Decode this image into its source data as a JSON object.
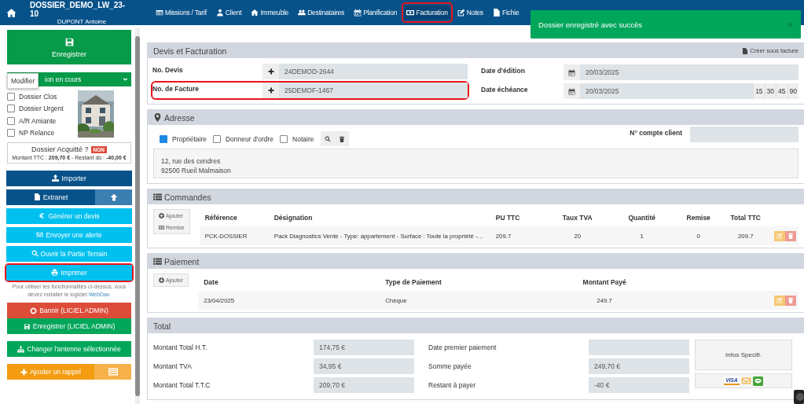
{
  "topbar": {
    "title": "DOSSIER_DEMO_LW_23-10",
    "subtitle": "DUPONT Antoine",
    "tabs": [
      {
        "label": "Missions / Tarif",
        "selected": false,
        "highlighted": false
      },
      {
        "label": "Client",
        "selected": false,
        "highlighted": false
      },
      {
        "label": "Immeuble",
        "selected": false,
        "highlighted": false
      },
      {
        "label": "Destinataires",
        "selected": false,
        "highlighted": false
      },
      {
        "label": "Planification",
        "selected": false,
        "highlighted": false
      },
      {
        "label": "Facturation",
        "selected": true,
        "highlighted": true
      },
      {
        "label": "Notes",
        "selected": false,
        "highlighted": false
      },
      {
        "label": "Fichie",
        "selected": false,
        "highlighted": false
      }
    ]
  },
  "toast": {
    "message": "Dossier enregistré avec succès",
    "close": "×"
  },
  "tooltip": "Modifier",
  "sidebar": {
    "save_button": "Enregistrer",
    "status": "ion en cours",
    "checkboxes": [
      {
        "label": "Dossier Clos",
        "checked": false
      },
      {
        "label": "Dossier Urgent",
        "checked": false
      },
      {
        "label": "A/R Amiante",
        "checked": false
      },
      {
        "label": "NP Relance",
        "checked": false
      }
    ],
    "acquitte": {
      "label": "Dossier Acquitté ?",
      "badge": "NON",
      "summary": "Montant TTC : **209,70 €** - Restant dû : **-40,00 €**"
    },
    "buttons": [
      {
        "label": "Importer",
        "kind": "primary",
        "highlighted": false
      },
      {
        "label": "Extranet",
        "kind": "primary",
        "highlighted": false
      },
      {
        "label": "Générer un devis",
        "kind": "info",
        "highlighted": false
      },
      {
        "label": "Envoyer une alerte",
        "kind": "info",
        "highlighted": false
      },
      {
        "label": "Ouvrir la Partie Terrain",
        "kind": "info",
        "highlighted": false
      },
      {
        "label": "Imprimer",
        "kind": "info",
        "highlighted": true
      }
    ],
    "note": {
      "text": "Pour utiliser les fonctionnalités ci-dessus, vous devez installer le logiciel",
      "link": "WebDav",
      "end": "."
    },
    "admin_buttons": [
      {
        "label": "Bannir (LICIEL ADMIN)",
        "kind": "danger"
      },
      {
        "label": "Enregistrer (LICIEL ADMIN)",
        "kind": "success"
      },
      {
        "label": "Changer l'antenne sélectionnée",
        "kind": "success"
      },
      {
        "label": "Ajouter un rappel",
        "kind": "warning"
      }
    ]
  },
  "devis": {
    "title": "Devis et Facturation",
    "create_link": "Créer sous facture",
    "fields": [
      {
        "label": "No. Devis",
        "value": "24DEMOD-2644",
        "highlighted": false
      },
      {
        "label": "No. de Facture",
        "value": "25DEMOF-1467",
        "highlighted": true
      }
    ],
    "dates": [
      {
        "label": "Date d'édition",
        "value": "20/03/2025"
      },
      {
        "label": "Date échéance",
        "value": "20/03/2025"
      }
    ],
    "delays": [
      "15",
      "30",
      "45",
      "90"
    ]
  },
  "adresse": {
    "title": "Adresse",
    "checkboxes": [
      {
        "label": "Propriétaire",
        "checked": true
      },
      {
        "label": "Donneur d'ordre",
        "checked": false
      },
      {
        "label": "Notaire",
        "checked": false
      }
    ],
    "account_label": "N° compte client",
    "lines": [
      "12, rue des cendres",
      "92500 Rueil Malmaison"
    ]
  },
  "commandes": {
    "title": "Commandes",
    "buttons": [
      "Ajouter",
      "Remise"
    ],
    "columns": [
      "Référence",
      "Désignation",
      "PU TTC",
      "Taux TVA",
      "Quantité",
      "Remise",
      "Total TTC"
    ],
    "rows": [
      [
        "PCK-DOSSIER",
        "Pack Diagnostics Vente - Type: appartement - Surface : Toute la propriété -…",
        "209.7",
        "20",
        "1",
        "0",
        "209.7"
      ]
    ]
  },
  "paiement": {
    "title": "Paiement",
    "buttons": [
      "Ajouter"
    ],
    "columns": [
      "Date",
      "Type de Paiement",
      "Montant Payé"
    ],
    "rows": [
      [
        "23/04/2025",
        "Chèque",
        "249.7"
      ]
    ]
  },
  "total": {
    "title": "Total",
    "left": [
      {
        "label": "Montant Total H.T.",
        "value": "174,75 €"
      },
      {
        "label": "Montant TVA",
        "value": "34,95 €"
      },
      {
        "label": "Montant Total T.T.C",
        "value": "209,70 €"
      }
    ],
    "right": [
      {
        "label": "Date premier paiement"
      },
      {
        "label": "Somme payée",
        "value": "249,70 €"
      },
      {
        "label": "Restant à payer",
        "value": "-40 €"
      }
    ],
    "infos_button": "Infos Specifi.",
    "card_label": "VISA"
  }
}
